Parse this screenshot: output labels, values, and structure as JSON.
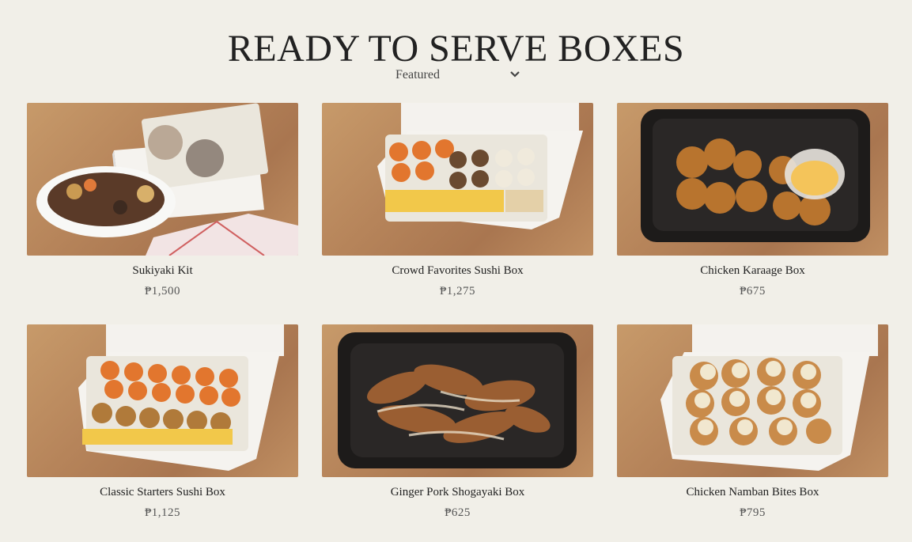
{
  "page": {
    "title": "READY TO SERVE BOXES"
  },
  "sort": {
    "selected": "Featured",
    "icon": "chevron-down-icon"
  },
  "products": [
    {
      "name": "Sukiyaki Kit",
      "price": "₱1,500"
    },
    {
      "name": "Crowd Favorites Sushi Box",
      "price": "₱1,275"
    },
    {
      "name": "Chicken Karaage Box",
      "price": "₱675"
    },
    {
      "name": "Classic Starters Sushi Box",
      "price": "₱1,125"
    },
    {
      "name": "Ginger Pork Shogayaki Box",
      "price": "₱625"
    },
    {
      "name": "Chicken Namban Bites Box",
      "price": "₱795"
    }
  ],
  "colors": {
    "background": "#f1efe8",
    "wood": "#b6845a"
  }
}
